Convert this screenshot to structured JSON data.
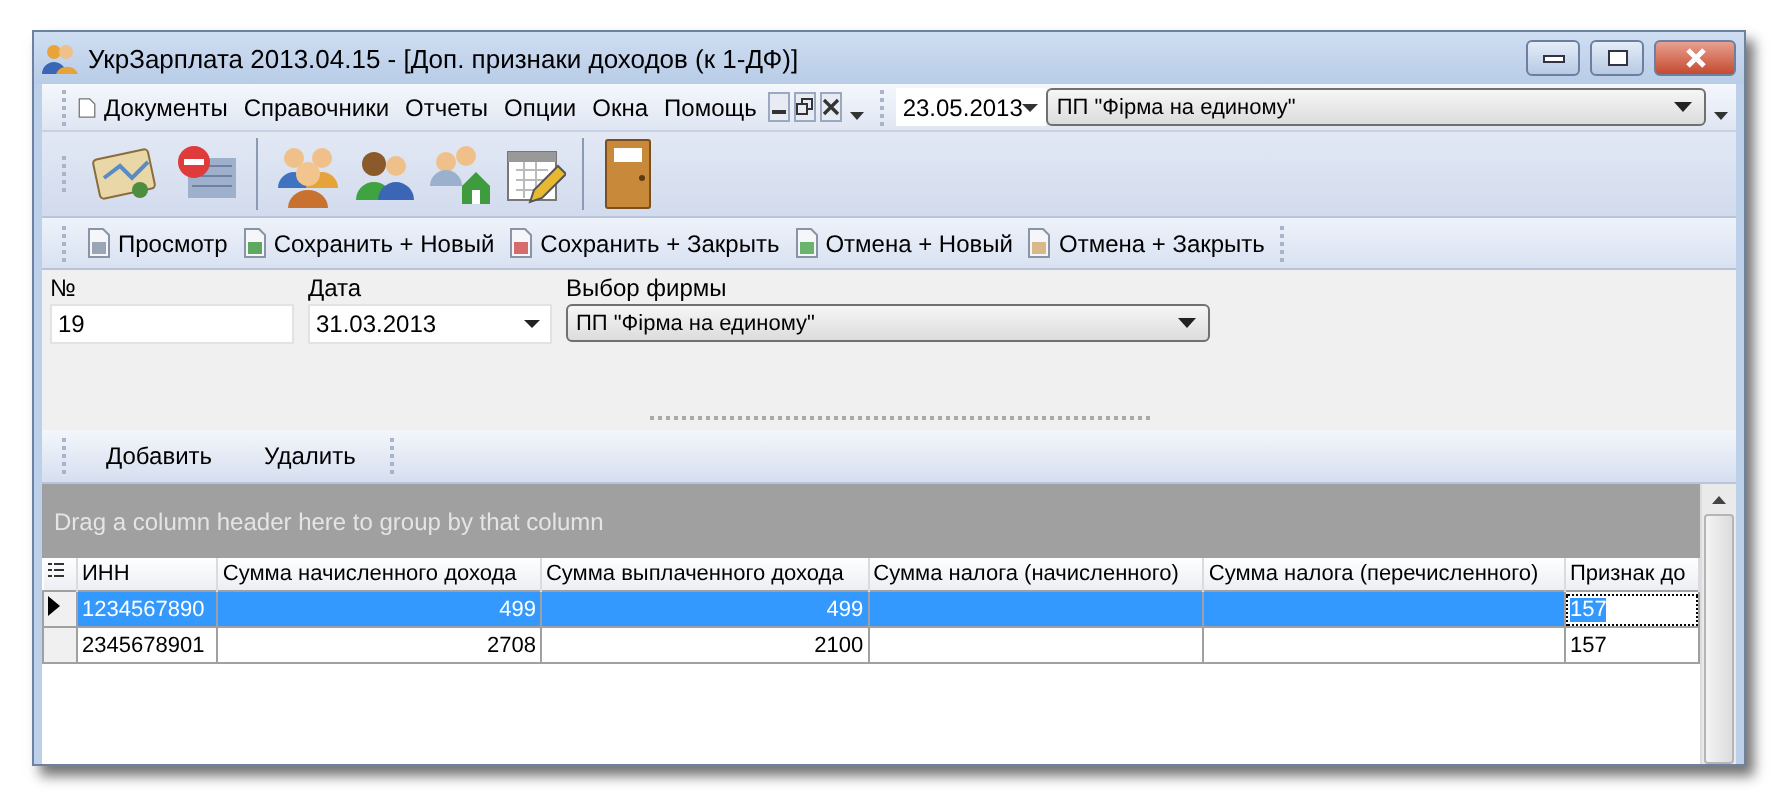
{
  "window": {
    "title": "УкрЗарплата 2013.04.15 - [Доп. признаки доходов (к 1-ДФ)]"
  },
  "menu": [
    "Документы",
    "Справочники",
    "Отчеты",
    "Опции",
    "Окна",
    "Помощь"
  ],
  "menu_date": {
    "value": "23.05.2013"
  },
  "menu_firm": {
    "value": "ПП \"Фірма на единому\""
  },
  "actions": [
    "Просмотр",
    "Сохранить + Новый",
    "Сохранить + Закрыть",
    "Отмена + Новый",
    "Отмена + Закрыть"
  ],
  "form": {
    "number": {
      "label": "№",
      "value": "19"
    },
    "date": {
      "label": "Дата",
      "value": "31.03.2013"
    },
    "firm": {
      "label": "Выбор фирмы",
      "value": "ПП \"Фірма на единому\""
    }
  },
  "grid_toolbar": [
    "Добавить",
    "Удалить"
  ],
  "group_panel": {
    "hint": "Drag a column header here to group by that column"
  },
  "table": {
    "columns": [
      "ИНН",
      "Сумма начисленного дохода",
      "Сумма выплаченного дохода",
      "Сумма налога (начисленного)",
      "Сумма налога (перечисленного)",
      "Признак до"
    ],
    "rows": [
      {
        "selected": true,
        "cells": [
          "1234567890",
          "499",
          "499",
          "",
          "",
          "157"
        ]
      },
      {
        "selected": false,
        "cells": [
          "2345678901",
          "2708",
          "2100",
          "",
          "",
          "157"
        ]
      }
    ]
  }
}
